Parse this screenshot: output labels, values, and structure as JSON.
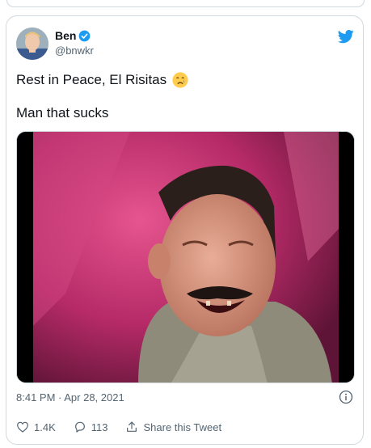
{
  "tweet": {
    "author_name": "Ben",
    "author_handle": "@bnwkr",
    "line1": "Rest in Peace, El Risitas",
    "emoji": "crying-face",
    "line2": "Man that sucks",
    "timestamp": "8:41 PM · Apr 28, 2021",
    "likes": "1.4K",
    "replies": "113",
    "share_label": "Share this Tweet"
  },
  "colors": {
    "twitter_blue": "#1d9bf0",
    "text": "#0f1419",
    "secondary_text": "#536471",
    "border": "#cfd9de"
  },
  "icons": {
    "brand": "twitter-bird-icon",
    "verified": "verified-badge-icon",
    "info": "info-icon",
    "like": "heart-icon",
    "reply": "reply-icon",
    "share": "share-icon"
  }
}
